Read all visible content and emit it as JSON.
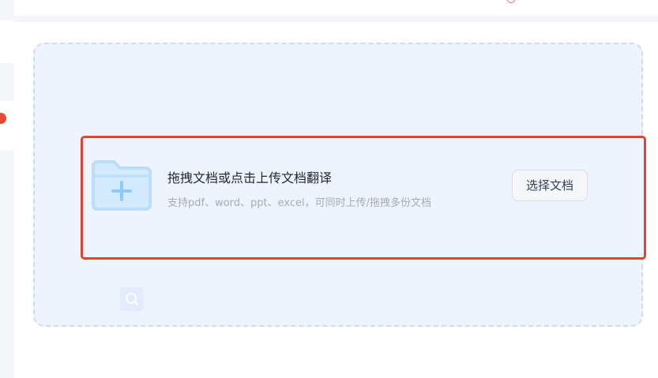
{
  "upload": {
    "title": "拖拽文档或点击上传文档翻译",
    "subtitle": "支持pdf、word、ppt、excel，可同时上传/拖拽多份文档",
    "select_label": "选择文档"
  },
  "icons": {
    "folder": "folder-add-icon",
    "search": "search-icon"
  },
  "colors": {
    "highlight_border": "#e2432f",
    "dropzone_bg": "#eef4fe",
    "folder_icon": "#b9ddfb"
  }
}
